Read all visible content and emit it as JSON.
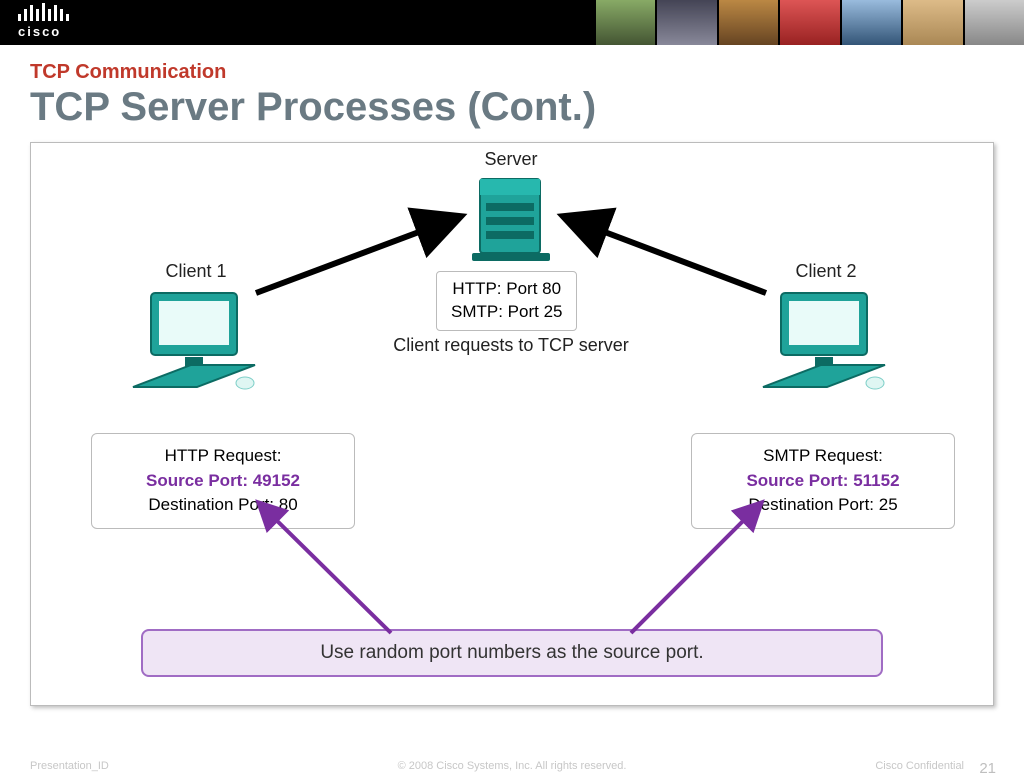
{
  "brand": "cisco",
  "kicker": "TCP Communication",
  "title": "TCP Server Processes (Cont.)",
  "diagram": {
    "server_label": "Server",
    "client1_label": "Client 1",
    "client2_label": "Client 2",
    "ports_box_l1": "HTTP: Port 80",
    "ports_box_l2": "SMTP: Port 25",
    "caption": "Client requests to TCP server",
    "req1": {
      "title": "HTTP Request:",
      "src": "Source Port: 49152",
      "dst": "Destination Port: 80"
    },
    "req2": {
      "title": "SMTP Request:",
      "src": "Source Port: 51152",
      "dst": "Destination Port: 25"
    },
    "callout": "Use random port numbers as the source port."
  },
  "footer": {
    "left": "Presentation_ID",
    "center": "© 2008 Cisco Systems, Inc. All rights reserved.",
    "right_label": "Cisco Confidential",
    "page": "21"
  }
}
